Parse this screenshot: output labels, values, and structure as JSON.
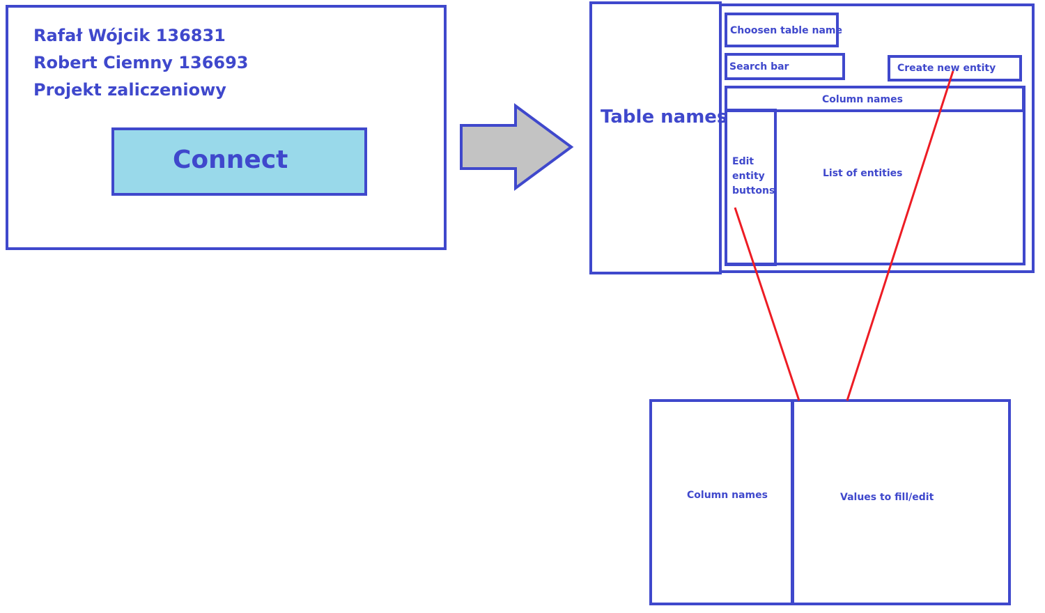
{
  "login": {
    "authors": [
      "Rafał Wójcik 136831",
      "Robert Ciemny 136693"
    ],
    "project": "Projekt zaliczeniowy",
    "connect_label": "Connect"
  },
  "main_screen": {
    "table_names": "Table names",
    "chosen_table_name": "Choosen table name",
    "search_bar": "Search bar",
    "create_new_entity": "Create new entity",
    "column_names": "Column names",
    "edit_entity_buttons": [
      "Edit",
      "entity",
      "buttons"
    ],
    "list_of_entities": "List of entities"
  },
  "entity_form": {
    "column_names": "Column names",
    "values": "Values to fill/edit"
  },
  "colors": {
    "outline": "#3f48cc",
    "button_fill": "#99d9ea",
    "arrow_fill": "#c3c3c3",
    "connector": "#ed1c24"
  }
}
